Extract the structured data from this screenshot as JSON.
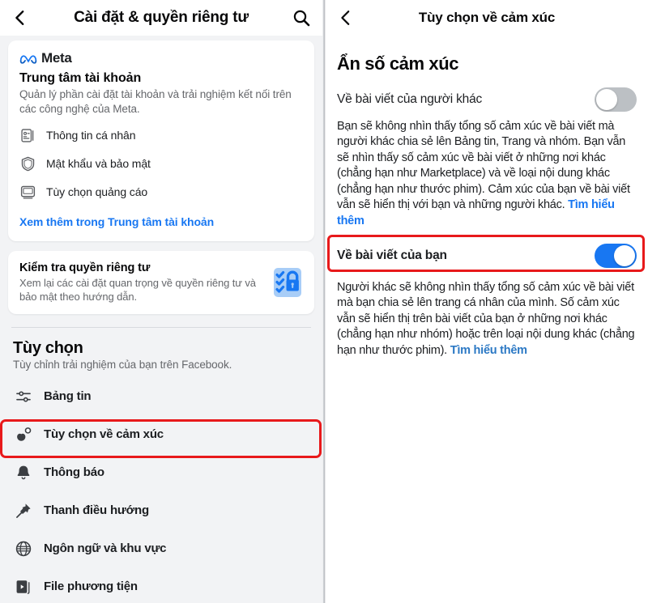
{
  "left": {
    "header": {
      "back_icon": "chevron-left-icon",
      "title": "Cài đặt & quyền riêng tư",
      "search_icon": "search-icon"
    },
    "account_center": {
      "brand_icon": "meta-infinity-logo",
      "brand": "Meta",
      "title": "Trung tâm tài khoản",
      "description": "Quản lý phần cài đặt tài khoản và trải nghiệm kết nối trên các công nghệ của Meta.",
      "items": [
        {
          "icon": "id-card-icon",
          "label": "Thông tin cá nhân"
        },
        {
          "icon": "shield-icon",
          "label": "Mật khẩu và bảo mật"
        },
        {
          "icon": "monitor-icon",
          "label": "Tùy chọn quảng cáo"
        }
      ],
      "link": "Xem thêm trong Trung tâm tài khoản"
    },
    "privacy_checkup": {
      "title": "Kiểm tra quyền riêng tư",
      "description": "Xem lại các cài đặt quan trọng về quyền riêng tư và bảo mật theo hướng dẫn.",
      "illustration_icon": "privacy-checklist-lock-icon"
    },
    "preferences": {
      "title": "Tùy chọn",
      "subtitle": "Tùy chỉnh trải nghiệm của bạn trên Facebook.",
      "items": [
        {
          "icon": "sliders-icon",
          "label": "Bảng tin",
          "highlighted": false
        },
        {
          "icon": "reactions-icon",
          "label": "Tùy chọn về cảm xúc",
          "highlighted": true
        },
        {
          "icon": "bell-icon",
          "label": "Thông báo",
          "highlighted": false
        },
        {
          "icon": "pin-icon",
          "label": "Thanh điều hướng",
          "highlighted": false
        },
        {
          "icon": "globe-icon",
          "label": "Ngôn ngữ và khu vực",
          "highlighted": false
        },
        {
          "icon": "media-file-icon",
          "label": "File phương tiện",
          "highlighted": false
        }
      ]
    }
  },
  "right": {
    "header": {
      "back_icon": "chevron-left-icon",
      "title": "Tùy chọn về cảm xúc"
    },
    "section_title": "Ẩn số cảm xúc",
    "rows": [
      {
        "label": "Về bài viết của người khác",
        "toggle_state": "off",
        "description": "Bạn sẽ không nhìn thấy tổng số cảm xúc về bài viết mà người khác chia sẻ lên Bảng tin, Trang và nhóm. Bạn vẫn sẽ nhìn thấy số cảm xúc về bài viết ở những nơi khác (chẳng hạn như Marketplace) và về loại nội dung khác (chẳng hạn như thước phim). Cảm xúc của bạn về bài viết vẫn sẽ hiển thị với bạn và những người khác.",
        "learn_more": "Tìm hiểu thêm",
        "highlighted": false
      },
      {
        "label": "Về bài viết của bạn",
        "toggle_state": "on",
        "description": "Người khác sẽ không nhìn thấy tổng số cảm xúc về bài viết mà bạn chia sẻ lên trang cá nhân của mình. Số cảm xúc vẫn sẽ hiển thị trên bài viết của bạn ở những nơi khác (chẳng hạn như nhóm) hoặc trên loại nội dung khác (chẳng hạn như thước phim).",
        "learn_more": "Tìm hiểu thêm",
        "highlighted": true
      }
    ]
  },
  "colors": {
    "accent_blue": "#1877f2",
    "highlight_red": "#e8191b",
    "text_primary": "#1c1e21",
    "text_secondary": "#65676b",
    "panel_bg": "#f2f3f5"
  }
}
